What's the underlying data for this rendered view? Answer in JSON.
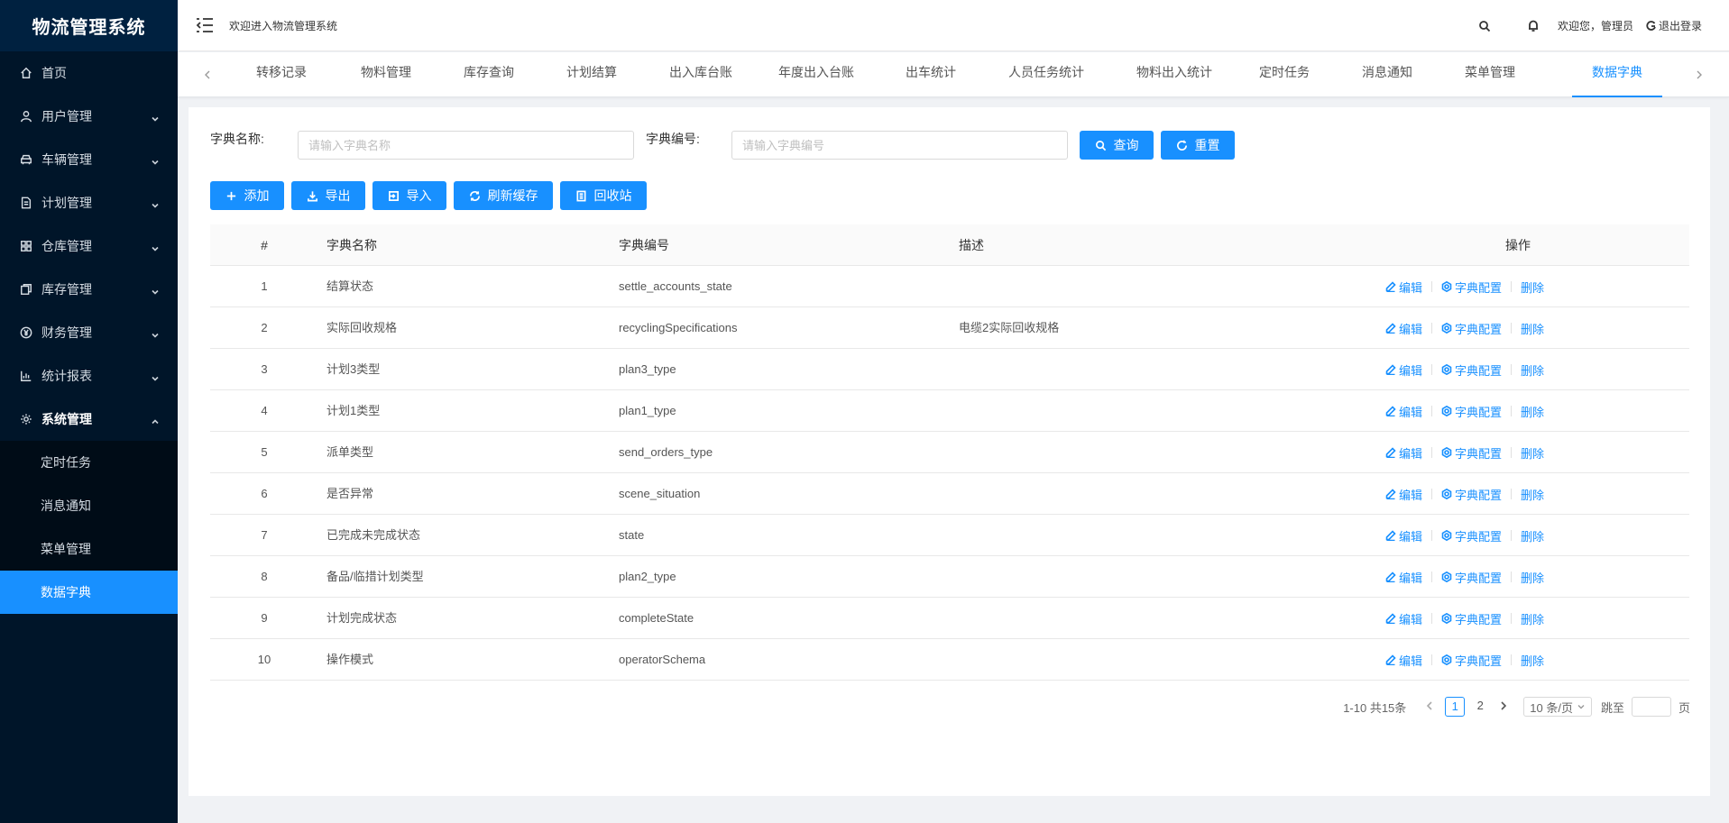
{
  "app": {
    "title": "物流管理系统"
  },
  "sidebar": {
    "items": [
      {
        "label": "首页",
        "icon": "home-icon",
        "caret": false
      },
      {
        "label": "用户管理",
        "icon": "user-icon",
        "caret": true
      },
      {
        "label": "车辆管理",
        "icon": "car-icon",
        "caret": true
      },
      {
        "label": "计划管理",
        "icon": "file-icon",
        "caret": true
      },
      {
        "label": "仓库管理",
        "icon": "grid-icon",
        "caret": true
      },
      {
        "label": "库存管理",
        "icon": "copy-icon",
        "caret": true
      },
      {
        "label": "财务管理",
        "icon": "yen-icon",
        "caret": true
      },
      {
        "label": "统计报表",
        "icon": "chart-icon",
        "caret": true
      },
      {
        "label": "系统管理",
        "icon": "gear-icon",
        "caret": true,
        "open": true
      }
    ],
    "subitems": [
      {
        "label": "定时任务"
      },
      {
        "label": "消息通知"
      },
      {
        "label": "菜单管理"
      },
      {
        "label": "数据字典",
        "active": true
      }
    ]
  },
  "header": {
    "welcome": "欢迎进入物流管理系统",
    "user_greeting": "欢迎您，管理员",
    "logout": "退出登录"
  },
  "tabs": [
    {
      "label": "转移记录"
    },
    {
      "label": "物料管理"
    },
    {
      "label": "库存查询"
    },
    {
      "label": "计划结算"
    },
    {
      "label": "出入库台账"
    },
    {
      "label": "年度出入台账"
    },
    {
      "label": "出车统计"
    },
    {
      "label": "人员任务统计"
    },
    {
      "label": "物料出入统计"
    },
    {
      "label": "定时任务"
    },
    {
      "label": "消息通知"
    },
    {
      "label": "菜单管理"
    },
    {
      "label": "数据字典",
      "active": true
    }
  ],
  "search": {
    "name_label": "字典名称:",
    "name_placeholder": "请输入字典名称",
    "code_label": "字典编号:",
    "code_placeholder": "请输入字典编号",
    "query_label": "查询",
    "reset_label": "重置"
  },
  "toolbar": {
    "add_label": "添加",
    "export_label": "导出",
    "import_label": "导入",
    "refresh_label": "刷新缓存",
    "recycle_label": "回收站"
  },
  "table": {
    "headers": {
      "index": "#",
      "name": "字典名称",
      "code": "字典编号",
      "desc": "描述",
      "ops": "操作"
    },
    "op_labels": {
      "edit": "编辑",
      "config": "字典配置",
      "delete": "删除"
    },
    "rows": [
      {
        "index": "1",
        "name": "结算状态",
        "code": "settle_accounts_state",
        "desc": ""
      },
      {
        "index": "2",
        "name": "实际回收规格",
        "code": "recyclingSpecifications",
        "desc": "电缆2实际回收规格"
      },
      {
        "index": "3",
        "name": "计划3类型",
        "code": "plan3_type",
        "desc": ""
      },
      {
        "index": "4",
        "name": "计划1类型",
        "code": "plan1_type",
        "desc": ""
      },
      {
        "index": "5",
        "name": "派单类型",
        "code": "send_orders_type",
        "desc": ""
      },
      {
        "index": "6",
        "name": "是否异常",
        "code": "scene_situation",
        "desc": ""
      },
      {
        "index": "7",
        "name": "已完成未完成状态",
        "code": "state",
        "desc": ""
      },
      {
        "index": "8",
        "name": "备品/临措计划类型",
        "code": "plan2_type",
        "desc": ""
      },
      {
        "index": "9",
        "name": "计划完成状态",
        "code": "completeState",
        "desc": ""
      },
      {
        "index": "10",
        "name": "操作模式",
        "code": "operatorSchema",
        "desc": ""
      }
    ]
  },
  "pagination": {
    "total_text": "1-10 共15条",
    "pages": [
      "1",
      "2"
    ],
    "current": "1",
    "page_size": "10 条/页",
    "jump_label": "跳至",
    "page_suffix": "页"
  },
  "colors": {
    "primary": "#1890ff",
    "sidebar": "#001529",
    "sidebar_sub": "#000c17"
  }
}
